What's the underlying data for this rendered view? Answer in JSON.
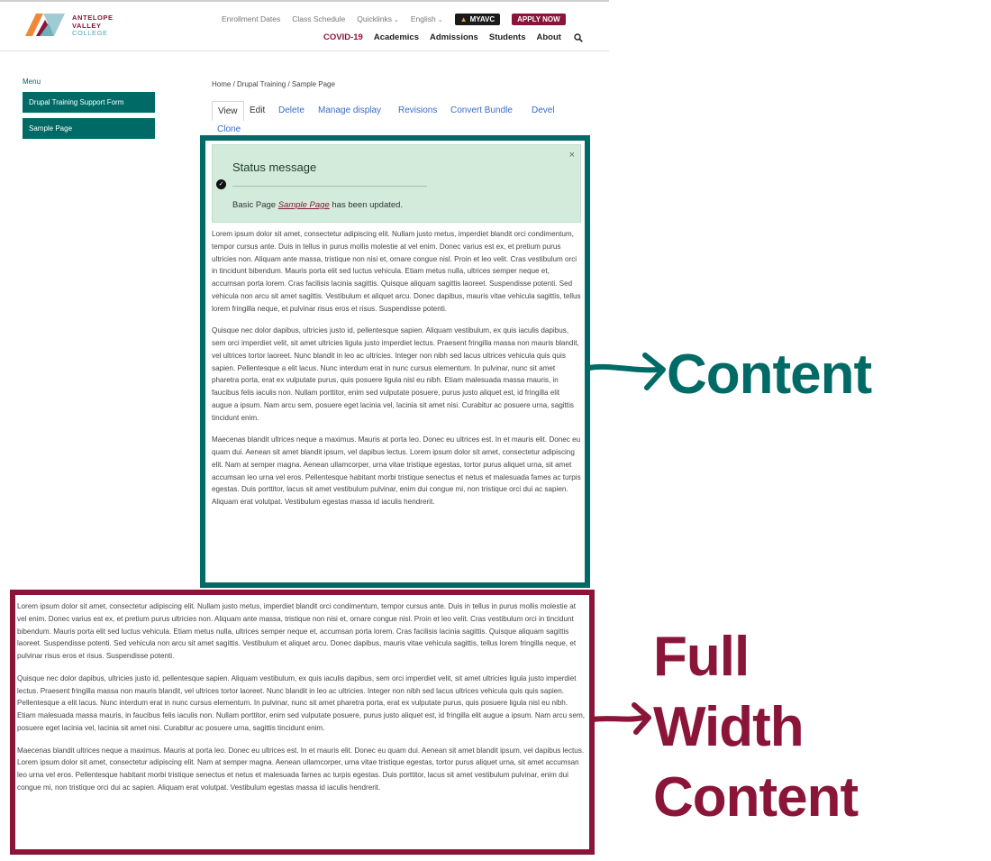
{
  "header": {
    "logo": {
      "line1": "ANTELOPE",
      "line2": "VALLEY",
      "line3": "COLLEGE"
    },
    "utility": {
      "enrollment_dates": "Enrollment Dates",
      "class_schedule": "Class Schedule",
      "quicklinks": "Quicklinks",
      "language": "English",
      "myavc": "MYAVC",
      "apply_now": "APPLY NOW"
    },
    "nav": {
      "covid": "COVID-19",
      "academics": "Academics",
      "admissions": "Admissions",
      "students": "Students",
      "about": "About"
    }
  },
  "sidebar": {
    "menu_label": "Menu",
    "items": [
      {
        "label": "Drupal Training Support Form"
      },
      {
        "label": "Sample Page"
      }
    ]
  },
  "breadcrumb": "Home / Drupal Training / Sample Page",
  "tabs": {
    "view": "View",
    "edit": "Edit",
    "delete": "Delete",
    "manage_display": "Manage display",
    "revisions": "Revisions",
    "convert_bundle": "Convert Bundle",
    "devel": "Devel",
    "clone": "Clone"
  },
  "status": {
    "title": "Status message",
    "text_prefix": "Basic Page ",
    "link": "Sample Page",
    "text_suffix": " has been updated.",
    "close": "×"
  },
  "content": {
    "paragraphs": [
      "Lorem ipsum dolor sit amet, consectetur adipiscing elit. Nullam justo metus, imperdiet blandit orci condimentum, tempor cursus ante. Duis in tellus in purus mollis molestie at vel enim. Donec varius est ex, et pretium purus ultricies non. Aliquam ante massa, tristique non nisi et, ornare congue nisl. Proin et leo velit. Cras vestibulum orci in tincidunt bibendum. Mauris porta elit sed luctus vehicula. Etiam metus nulla, ultrices semper neque et, accumsan porta lorem. Cras facilisis lacinia sagittis. Quisque aliquam sagittis laoreet. Suspendisse potenti. Sed vehicula non arcu sit amet sagittis. Vestibulum et aliquet arcu. Donec dapibus, mauris vitae vehicula sagittis, tellus lorem fringilla neque, et pulvinar risus eros et risus. Suspendisse potenti.",
      "Quisque nec dolor dapibus, ultricies justo id, pellentesque sapien. Aliquam vestibulum, ex quis iaculis dapibus, sem orci imperdiet velit, sit amet ultricies ligula justo imperdiet lectus. Praesent fringilla massa non mauris blandit, vel ultrices tortor laoreet. Nunc blandit in leo ac ultricies. Integer non nibh sed lacus ultrices vehicula quis quis sapien. Pellentesque a elit lacus. Nunc interdum erat in nunc cursus elementum. In pulvinar, nunc sit amet pharetra porta, erat ex vulputate purus, quis posuere ligula nisl eu nibh. Etiam malesuada massa mauris, in faucibus felis iaculis non. Nullam porttitor, enim sed vulputate posuere, purus justo aliquet est, id fringilla elit augue a ipsum. Nam arcu sem, posuere eget lacinia vel, lacinia sit amet nisi. Curabitur ac posuere urna, sagittis tincidunt enim.",
      "Maecenas blandit ultrices neque a maximus. Mauris at porta leo. Donec eu ultrices est. In et mauris elit. Donec eu quam dui. Aenean sit amet blandit ipsum, vel dapibus lectus. Lorem ipsum dolor sit amet, consectetur adipiscing elit. Nam at semper magna. Aenean ullamcorper, urna vitae tristique egestas, tortor purus aliquet urna, sit amet accumsan leo urna vel eros. Pellentesque habitant morbi tristique senectus et netus et malesuada fames ac turpis egestas. Duis porttitor, lacus sit amet vestibulum pulvinar, enim dui congue mi, non tristique orci dui ac sapien. Aliquam erat volutpat. Vestibulum egestas massa id iaculis hendrerit."
    ]
  },
  "annotations": {
    "content_label": "Content",
    "full_width_line1": "Full",
    "full_width_line2": "Width",
    "full_width_line3": "Content"
  },
  "colors": {
    "teal": "#006b66",
    "maroon": "#8a1538",
    "status_bg": "#d3ebdb"
  }
}
